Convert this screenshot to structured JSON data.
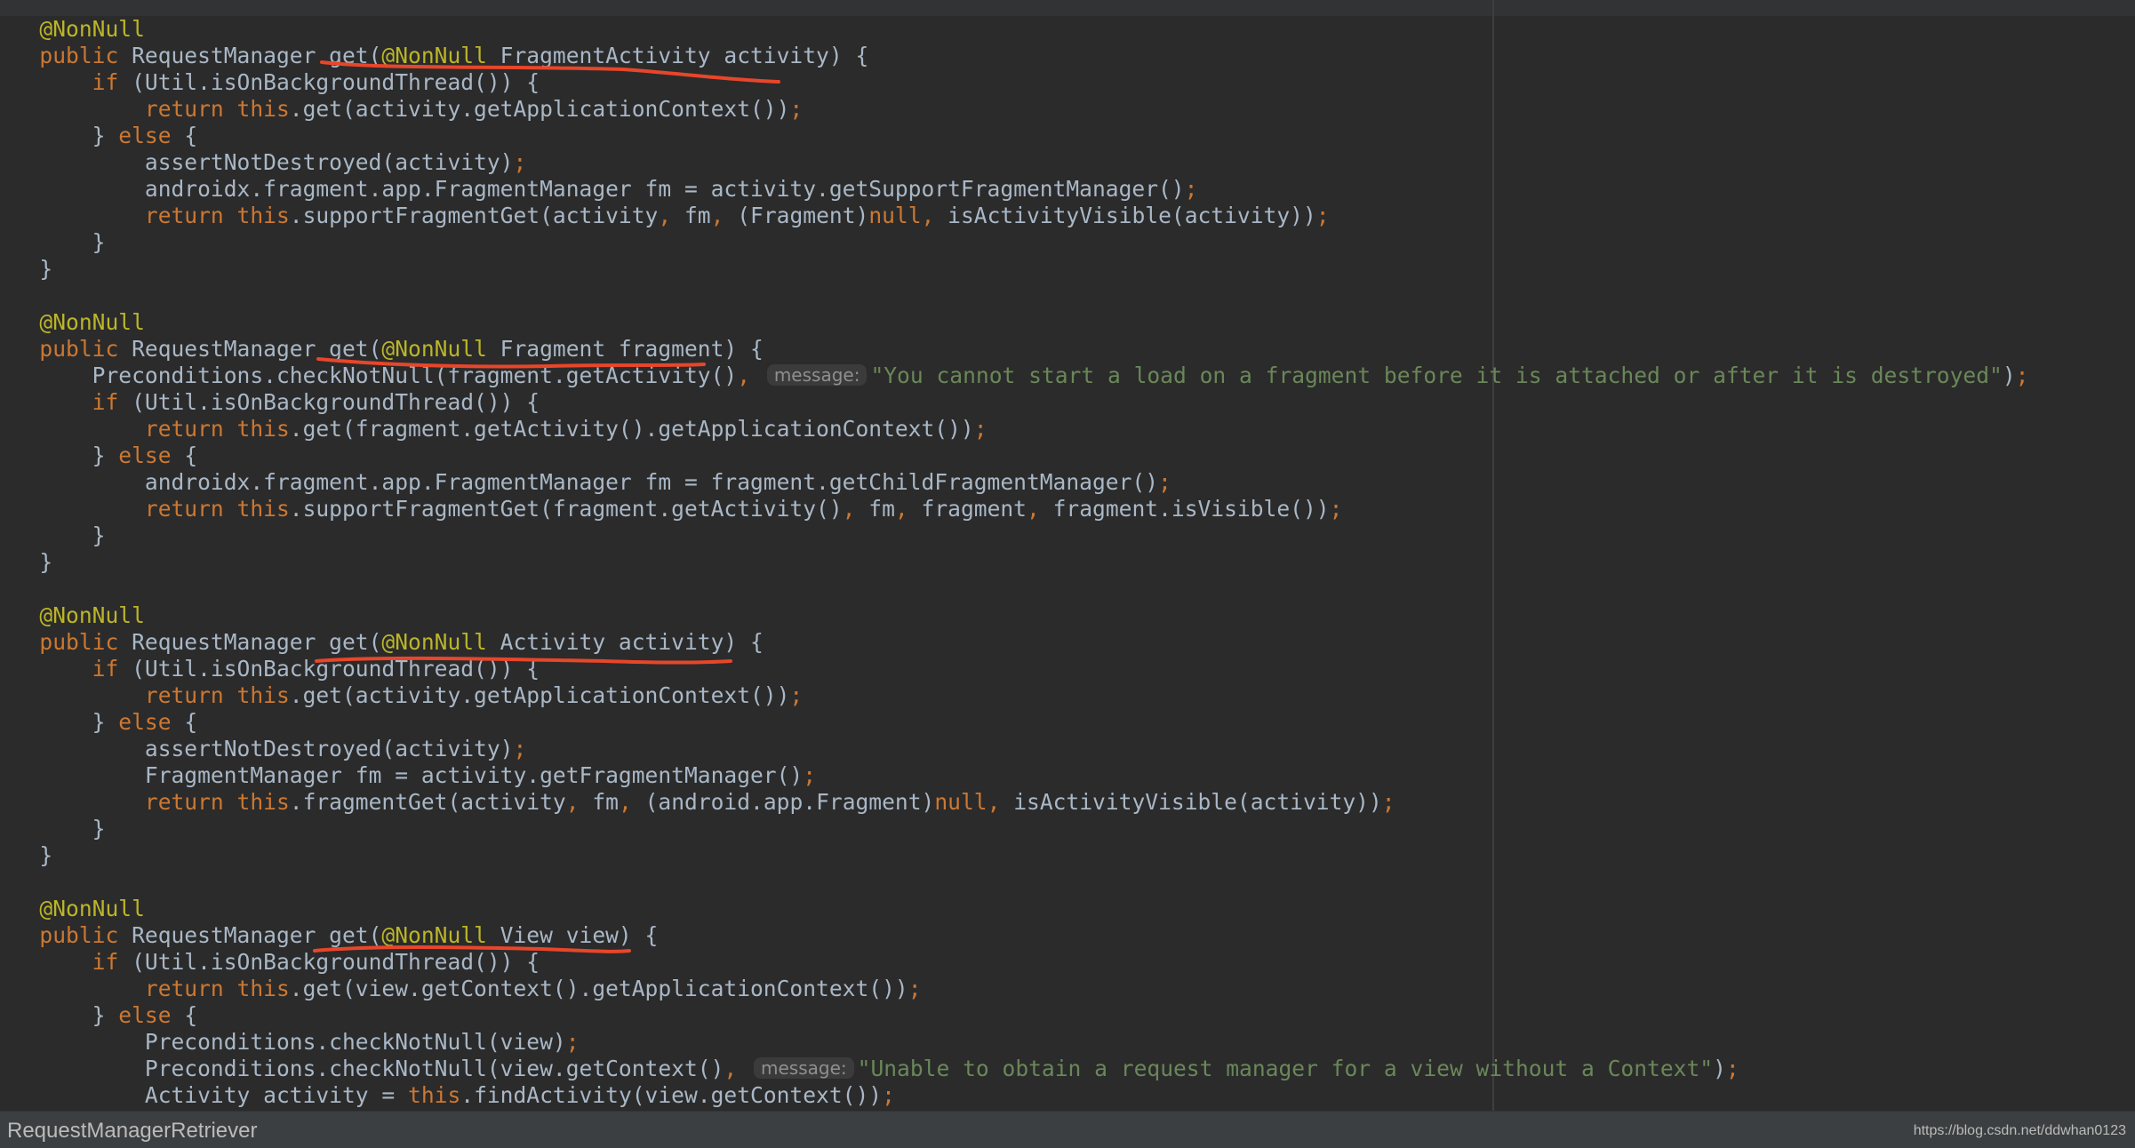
{
  "editor": {
    "file_name": "RequestManagerRetriever",
    "watermark": "https://blog.csdn.net/ddwhan0123",
    "colors": {
      "background": "#2b2b2b",
      "keyword": "#cc7832",
      "string": "#6a8759",
      "annotation": "#bbb529",
      "identifier": "#a9b7c6",
      "underline_mark": "#e8462a"
    },
    "lines": [
      {
        "indent": "",
        "tokens": [
          {
            "k": "ann",
            "t": "@NonNull"
          }
        ]
      },
      {
        "indent": "",
        "tokens": [
          {
            "k": "kw",
            "t": "public "
          },
          {
            "k": "plain",
            "t": "RequestManager get("
          },
          {
            "k": "ann",
            "t": "@NonNull "
          },
          {
            "k": "plain",
            "t": "FragmentActivity activity) {"
          }
        ]
      },
      {
        "indent": "    ",
        "tokens": [
          {
            "k": "kw",
            "t": "if "
          },
          {
            "k": "plain",
            "t": "(Util.isOnBackgroundThread()) {"
          }
        ]
      },
      {
        "indent": "        ",
        "tokens": [
          {
            "k": "kw",
            "t": "return this"
          },
          {
            "k": "plain",
            "t": ".get(activity.getApplicationContext())"
          },
          {
            "k": "punc",
            "t": ";"
          }
        ]
      },
      {
        "indent": "    ",
        "tokens": [
          {
            "k": "plain",
            "t": "} "
          },
          {
            "k": "kw",
            "t": "else "
          },
          {
            "k": "plain",
            "t": "{"
          }
        ]
      },
      {
        "indent": "        ",
        "tokens": [
          {
            "k": "plain",
            "t": "assertNotDestroyed(activity)"
          },
          {
            "k": "punc",
            "t": ";"
          }
        ]
      },
      {
        "indent": "        ",
        "tokens": [
          {
            "k": "plain",
            "t": "androidx.fragment.app.FragmentManager fm = activity.getSupportFragmentManager()"
          },
          {
            "k": "punc",
            "t": ";"
          }
        ]
      },
      {
        "indent": "        ",
        "tokens": [
          {
            "k": "kw",
            "t": "return this"
          },
          {
            "k": "plain",
            "t": ".supportFragmentGet(activity"
          },
          {
            "k": "punc",
            "t": ", "
          },
          {
            "k": "plain",
            "t": "fm"
          },
          {
            "k": "punc",
            "t": ", "
          },
          {
            "k": "plain",
            "t": "(Fragment)"
          },
          {
            "k": "kw",
            "t": "null"
          },
          {
            "k": "punc",
            "t": ", "
          },
          {
            "k": "plain",
            "t": "isActivityVisible(activity))"
          },
          {
            "k": "punc",
            "t": ";"
          }
        ]
      },
      {
        "indent": "    ",
        "tokens": [
          {
            "k": "plain",
            "t": "}"
          }
        ]
      },
      {
        "indent": "",
        "tokens": [
          {
            "k": "plain",
            "t": "}"
          }
        ]
      },
      {
        "indent": "",
        "tokens": []
      },
      {
        "indent": "",
        "tokens": [
          {
            "k": "ann",
            "t": "@NonNull"
          }
        ]
      },
      {
        "indent": "",
        "tokens": [
          {
            "k": "kw",
            "t": "public "
          },
          {
            "k": "plain",
            "t": "RequestManager get("
          },
          {
            "k": "ann",
            "t": "@NonNull "
          },
          {
            "k": "plain",
            "t": "Fragment fragment) {"
          }
        ]
      },
      {
        "indent": "    ",
        "tokens": [
          {
            "k": "plain",
            "t": "Preconditions.checkNotNull(fragment.getActivity()"
          },
          {
            "k": "punc",
            "t": ", "
          },
          {
            "k": "hint",
            "t": "message:"
          },
          {
            "k": "str",
            "t": "\"You cannot start a load on a fragment before it is attached or after it is destroyed\""
          },
          {
            "k": "plain",
            "t": ")"
          },
          {
            "k": "punc",
            "t": ";"
          }
        ]
      },
      {
        "indent": "    ",
        "tokens": [
          {
            "k": "kw",
            "t": "if "
          },
          {
            "k": "plain",
            "t": "(Util.isOnBackgroundThread()) {"
          }
        ]
      },
      {
        "indent": "        ",
        "tokens": [
          {
            "k": "kw",
            "t": "return this"
          },
          {
            "k": "plain",
            "t": ".get(fragment.getActivity().getApplicationContext())"
          },
          {
            "k": "punc",
            "t": ";"
          }
        ]
      },
      {
        "indent": "    ",
        "tokens": [
          {
            "k": "plain",
            "t": "} "
          },
          {
            "k": "kw",
            "t": "else "
          },
          {
            "k": "plain",
            "t": "{"
          }
        ]
      },
      {
        "indent": "        ",
        "tokens": [
          {
            "k": "plain",
            "t": "androidx.fragment.app.FragmentManager fm = fragment.getChildFragmentManager()"
          },
          {
            "k": "punc",
            "t": ";"
          }
        ]
      },
      {
        "indent": "        ",
        "tokens": [
          {
            "k": "kw",
            "t": "return this"
          },
          {
            "k": "plain",
            "t": ".supportFragmentGet(fragment.getActivity()"
          },
          {
            "k": "punc",
            "t": ", "
          },
          {
            "k": "plain",
            "t": "fm"
          },
          {
            "k": "punc",
            "t": ", "
          },
          {
            "k": "plain",
            "t": "fragment"
          },
          {
            "k": "punc",
            "t": ", "
          },
          {
            "k": "plain",
            "t": "fragment.isVisible())"
          },
          {
            "k": "punc",
            "t": ";"
          }
        ]
      },
      {
        "indent": "    ",
        "tokens": [
          {
            "k": "plain",
            "t": "}"
          }
        ]
      },
      {
        "indent": "",
        "tokens": [
          {
            "k": "plain",
            "t": "}"
          }
        ]
      },
      {
        "indent": "",
        "tokens": []
      },
      {
        "indent": "",
        "tokens": [
          {
            "k": "ann",
            "t": "@NonNull"
          }
        ]
      },
      {
        "indent": "",
        "tokens": [
          {
            "k": "kw",
            "t": "public "
          },
          {
            "k": "plain",
            "t": "RequestManager get("
          },
          {
            "k": "ann",
            "t": "@NonNull "
          },
          {
            "k": "plain",
            "t": "Activity activity) {"
          }
        ]
      },
      {
        "indent": "    ",
        "tokens": [
          {
            "k": "kw",
            "t": "if "
          },
          {
            "k": "plain",
            "t": "(Util.isOnBackgroundThread()) {"
          }
        ]
      },
      {
        "indent": "        ",
        "tokens": [
          {
            "k": "kw",
            "t": "return this"
          },
          {
            "k": "plain",
            "t": ".get(activity.getApplicationContext())"
          },
          {
            "k": "punc",
            "t": ";"
          }
        ]
      },
      {
        "indent": "    ",
        "tokens": [
          {
            "k": "plain",
            "t": "} "
          },
          {
            "k": "kw",
            "t": "else "
          },
          {
            "k": "plain",
            "t": "{"
          }
        ]
      },
      {
        "indent": "        ",
        "tokens": [
          {
            "k": "plain",
            "t": "assertNotDestroyed(activity)"
          },
          {
            "k": "punc",
            "t": ";"
          }
        ]
      },
      {
        "indent": "        ",
        "tokens": [
          {
            "k": "plain",
            "t": "FragmentManager fm = activity.getFragmentManager()"
          },
          {
            "k": "punc",
            "t": ";"
          }
        ]
      },
      {
        "indent": "        ",
        "tokens": [
          {
            "k": "kw",
            "t": "return this"
          },
          {
            "k": "plain",
            "t": ".fragmentGet(activity"
          },
          {
            "k": "punc",
            "t": ", "
          },
          {
            "k": "plain",
            "t": "fm"
          },
          {
            "k": "punc",
            "t": ", "
          },
          {
            "k": "plain",
            "t": "(android.app.Fragment)"
          },
          {
            "k": "kw",
            "t": "null"
          },
          {
            "k": "punc",
            "t": ", "
          },
          {
            "k": "plain",
            "t": "isActivityVisible(activity))"
          },
          {
            "k": "punc",
            "t": ";"
          }
        ]
      },
      {
        "indent": "    ",
        "tokens": [
          {
            "k": "plain",
            "t": "}"
          }
        ]
      },
      {
        "indent": "",
        "tokens": [
          {
            "k": "plain",
            "t": "}"
          }
        ]
      },
      {
        "indent": "",
        "tokens": []
      },
      {
        "indent": "",
        "tokens": [
          {
            "k": "ann",
            "t": "@NonNull"
          }
        ]
      },
      {
        "indent": "",
        "tokens": [
          {
            "k": "kw",
            "t": "public "
          },
          {
            "k": "plain",
            "t": "RequestManager get("
          },
          {
            "k": "ann",
            "t": "@NonNull "
          },
          {
            "k": "plain",
            "t": "View view) {"
          }
        ]
      },
      {
        "indent": "    ",
        "tokens": [
          {
            "k": "kw",
            "t": "if "
          },
          {
            "k": "plain",
            "t": "(Util.isOnBackgroundThread()) {"
          }
        ]
      },
      {
        "indent": "        ",
        "tokens": [
          {
            "k": "kw",
            "t": "return this"
          },
          {
            "k": "plain",
            "t": ".get(view.getContext().getApplicationContext())"
          },
          {
            "k": "punc",
            "t": ";"
          }
        ]
      },
      {
        "indent": "    ",
        "tokens": [
          {
            "k": "plain",
            "t": "} "
          },
          {
            "k": "kw",
            "t": "else "
          },
          {
            "k": "plain",
            "t": "{"
          }
        ]
      },
      {
        "indent": "        ",
        "tokens": [
          {
            "k": "plain",
            "t": "Preconditions.checkNotNull(view)"
          },
          {
            "k": "punc",
            "t": ";"
          }
        ]
      },
      {
        "indent": "        ",
        "tokens": [
          {
            "k": "plain",
            "t": "Preconditions.checkNotNull(view.getContext()"
          },
          {
            "k": "punc",
            "t": ", "
          },
          {
            "k": "hint",
            "t": "message:"
          },
          {
            "k": "str",
            "t": "\"Unable to obtain a request manager for a view without a Context\""
          },
          {
            "k": "plain",
            "t": ")"
          },
          {
            "k": "punc",
            "t": ";"
          }
        ]
      },
      {
        "indent": "        ",
        "tokens": [
          {
            "k": "plain",
            "t": "Activity activity = "
          },
          {
            "k": "kw",
            "t": "this"
          },
          {
            "k": "plain",
            "t": ".findActivity(view.getContext())"
          },
          {
            "k": "punc",
            "t": ";"
          }
        ]
      }
    ]
  }
}
